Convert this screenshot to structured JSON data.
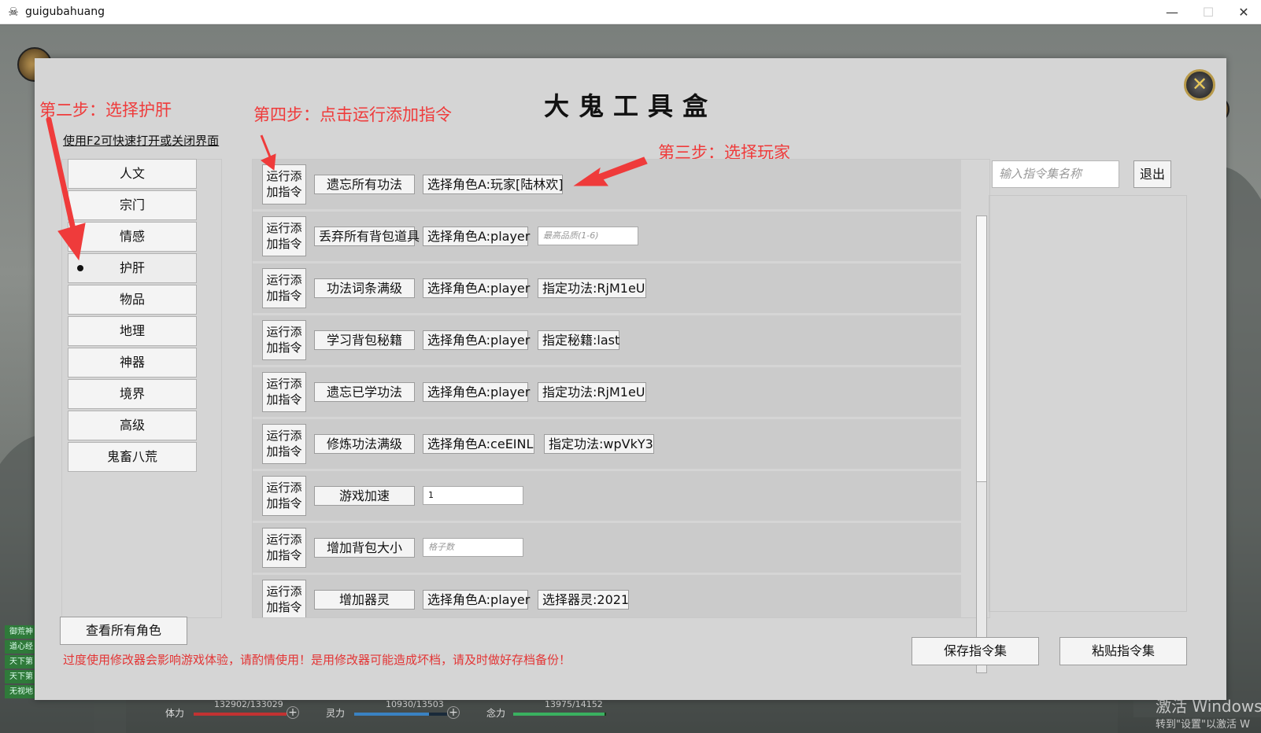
{
  "window": {
    "title": "guigubahuang"
  },
  "dialog": {
    "title": "大鬼工具盒",
    "hint": "使用F2可快速打开或关闭界面",
    "categories": [
      {
        "label": "人文"
      },
      {
        "label": "宗门"
      },
      {
        "label": "情感"
      },
      {
        "label": "护肝",
        "selected": true
      },
      {
        "label": "物品"
      },
      {
        "label": "地理"
      },
      {
        "label": "神器"
      },
      {
        "label": "境界"
      },
      {
        "label": "高级"
      },
      {
        "label": "鬼畜八荒"
      }
    ],
    "run_label": "运行添加指令",
    "commands": [
      {
        "name": "遗忘所有功法",
        "role": "选择角色A:玩家[陆林欢]"
      },
      {
        "name": "丢弃所有背包道具",
        "role": "选择角色A:player",
        "placeholder": "最高品质(1-6)"
      },
      {
        "name": "功法词条满级",
        "role": "选择角色A:player",
        "extra": "指定功法:RjM1eU"
      },
      {
        "name": "学习背包秘籍",
        "role": "选择角色A:player",
        "extra": "指定秘籍:last"
      },
      {
        "name": "遗忘已学功法",
        "role": "选择角色A:player",
        "extra": "指定功法:RjM1eU"
      },
      {
        "name": "修炼功法满级",
        "role": "选择角色A:ceEINL",
        "extra": "指定功法:wpVkY3"
      },
      {
        "name": "游戏加速",
        "value": "1"
      },
      {
        "name": "增加背包大小",
        "placeholder": "格子数"
      },
      {
        "name": "增加器灵",
        "role": "选择角色A:player",
        "extra": "选择器灵:2021"
      }
    ],
    "set_name_placeholder": "输入指令集名称",
    "exit_label": "退出",
    "view_all_label": "查看所有角色",
    "warning": "过度使用修改器会影响游戏体验，请酌情使用！是用修改器可能造成坏档，请及时做好存档备份！",
    "save_label": "保存指令集",
    "paste_label": "粘贴指令集"
  },
  "annotations": {
    "step2": "第二步：选择护肝",
    "step3": "第三步：选择玩家",
    "step4": "第四步：点击运行添加指令",
    "color": "#ef3b3b"
  },
  "status": {
    "hp_label": "体力",
    "hp_value": "132902/133029",
    "hp_fraction": 0.999,
    "sp_label": "灵力",
    "sp_value": "10930/13503",
    "sp_fraction": 0.809,
    "mind_label": "念力",
    "mind_value": "13975/14152",
    "mind_fraction": 0.987
  },
  "chat_channels": [
    "御荒神",
    "道心经",
    "天下第",
    "天下第",
    "无视地"
  ],
  "watermark": {
    "line1": "激活 Windows",
    "line2": "转到\"设置\"以激活 W"
  }
}
